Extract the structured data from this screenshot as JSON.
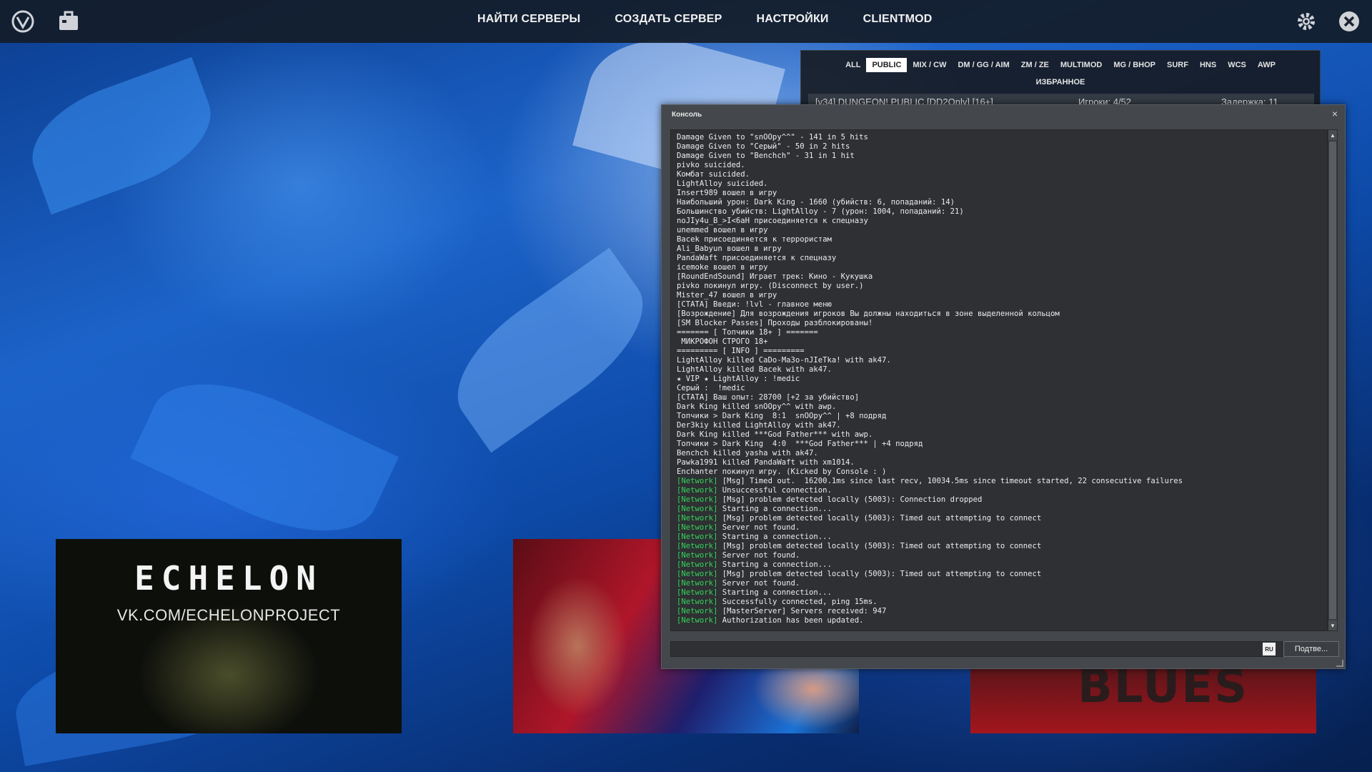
{
  "nav": {
    "items": [
      "НАЙТИ СЕРВЕРЫ",
      "СОЗДАТЬ СЕРВЕР",
      "НАСТРОЙКИ",
      "CLIENTMOD"
    ]
  },
  "icons": {
    "logo": "shield-logo-icon",
    "inventory": "briefcase-icon",
    "settings": "gear-icon",
    "close": "close-icon"
  },
  "browser": {
    "filters": [
      "ALL",
      "PUBLIC",
      "MIX / CW",
      "DM / GG / AIM",
      "ZM / ZE",
      "MULTIMOD",
      "MG / BHOP",
      "SURF",
      "HNS",
      "WCS",
      "AWP",
      "ИЗБРАННОЕ"
    ],
    "active_filter": "PUBLIC",
    "first_row": {
      "name": "[v34] DUNGEON! PUBLIC [DD2Only] [16+]",
      "players": "Игроки: 4/52",
      "latency": "Задержка: 11"
    }
  },
  "banners": {
    "echelon_logo": "ECHELON",
    "echelon_url": "VK.COM/ECHELONPROJECT",
    "blues_text": "BLUES"
  },
  "console": {
    "title": "Консоль",
    "close": "×",
    "input_value": "",
    "lang": "RU",
    "submit_label": "Подтве...",
    "lines": [
      {
        "tag": "",
        "text": "Damage Given to \"snOOpy^^\" - 141 in 5 hits"
      },
      {
        "tag": "",
        "text": "Damage Given to \"Серый\" - 50 in 2 hits"
      },
      {
        "tag": "",
        "text": "Damage Given to \"Benchch\" - 31 in 1 hit"
      },
      {
        "tag": "",
        "text": "pivko suicided."
      },
      {
        "tag": "",
        "text": "Комбат suicided."
      },
      {
        "tag": "",
        "text": "LightAlloy suicided."
      },
      {
        "tag": "",
        "text": "Insert989 вошел в игру"
      },
      {
        "tag": "",
        "text": "Наибольший урон: Dark King - 1660 (убийств: 6, попаданий: 14)"
      },
      {
        "tag": "",
        "text": "Большинство убийств: LightAlloy - 7 (урон: 1004, попаданий: 21)"
      },
      {
        "tag": "",
        "text": "noJIy4u_B_>I<6aH присоединяется к спецназу"
      },
      {
        "tag": "",
        "text": "unemmed вошел в игру"
      },
      {
        "tag": "",
        "text": "Bacek присоединяется к террористам"
      },
      {
        "tag": "",
        "text": "Ali_Babyun вошел в игру"
      },
      {
        "tag": "",
        "text": "PandaWaft присоединяется к спецназу"
      },
      {
        "tag": "",
        "text": "icemoke вошел в игру"
      },
      {
        "tag": "",
        "text": "[RoundEndSound] Играет трек: Кино - Кукушка"
      },
      {
        "tag": "",
        "text": "pivko покинул игру. (Disconnect by user.)"
      },
      {
        "tag": "",
        "text": "Mister_47 вошел в игру"
      },
      {
        "tag": "",
        "text": "[СТАТА] Введи: !lvl - главное меню"
      },
      {
        "tag": "",
        "text": "[Возрождение] Для возрождения игроков Вы должны находиться в зоне выделенной кольцом"
      },
      {
        "tag": "",
        "text": "[SM Blocker Passes] Проходы разблокированы!"
      },
      {
        "tag": "",
        "text": "======= [ Топчики 18+ ] ======="
      },
      {
        "tag": "",
        "text": " МИКРОФОН СТРОГО 18+"
      },
      {
        "tag": "",
        "text": "========= [ INFO ] ========="
      },
      {
        "tag": "",
        "text": "LightAlloy killed CaDo-Ma3o-nJIeTka! with ak47."
      },
      {
        "tag": "",
        "text": "LightAlloy killed Bacek with ak47."
      },
      {
        "tag": "",
        "text": "★ VIP ★ LightAlloy : !medic"
      },
      {
        "tag": "",
        "text": "Серый :  !medic"
      },
      {
        "tag": "",
        "text": "[СТАТА] Ваш опыт: 28700 [+2 за убийство]"
      },
      {
        "tag": "",
        "text": "Dark King killed snOOpy^^ with awp."
      },
      {
        "tag": "",
        "text": "Топчики > Dark King  8:1  snOOpy^^ | +8 подряд"
      },
      {
        "tag": "",
        "text": "Der3kiy killed LightAlloy with ak47."
      },
      {
        "tag": "",
        "text": "Dark King killed ***God Father*** with awp."
      },
      {
        "tag": "",
        "text": "Топчики > Dark King  4:0  ***God Father*** | +4 подряд"
      },
      {
        "tag": "",
        "text": "Benchch killed yasha with ak47."
      },
      {
        "tag": "",
        "text": "Pawka1991 killed PandaWaft with xm1014."
      },
      {
        "tag": "",
        "text": "Enchanter покинул игру. (Kicked by Console : )"
      },
      {
        "tag": "[Network]",
        "text": " [Msg] Timed out.  16200.1ms since last recv, 10034.5ms since timeout started, 22 consecutive failures"
      },
      {
        "tag": "[Network]",
        "text": " Unsuccessful connection."
      },
      {
        "tag": "[Network]",
        "text": " [Msg] problem detected locally (5003): Connection dropped"
      },
      {
        "tag": "[Network]",
        "text": " Starting a connection..."
      },
      {
        "tag": "[Network]",
        "text": " [Msg] problem detected locally (5003): Timed out attempting to connect"
      },
      {
        "tag": "[Network]",
        "text": " Server not found."
      },
      {
        "tag": "[Network]",
        "text": " Starting a connection..."
      },
      {
        "tag": "[Network]",
        "text": " [Msg] problem detected locally (5003): Timed out attempting to connect"
      },
      {
        "tag": "[Network]",
        "text": " Server not found."
      },
      {
        "tag": "[Network]",
        "text": " Starting a connection..."
      },
      {
        "tag": "[Network]",
        "text": " [Msg] problem detected locally (5003): Timed out attempting to connect"
      },
      {
        "tag": "[Network]",
        "text": " Server not found."
      },
      {
        "tag": "[Network]",
        "text": " Starting a connection..."
      },
      {
        "tag": "[Network]",
        "text": " Successfully connected, ping 15ms."
      },
      {
        "tag": "[Network]",
        "text": " [MasterServer] Servers received: 947"
      },
      {
        "tag": "[Network]",
        "text": " Authorization has been updated."
      }
    ]
  }
}
